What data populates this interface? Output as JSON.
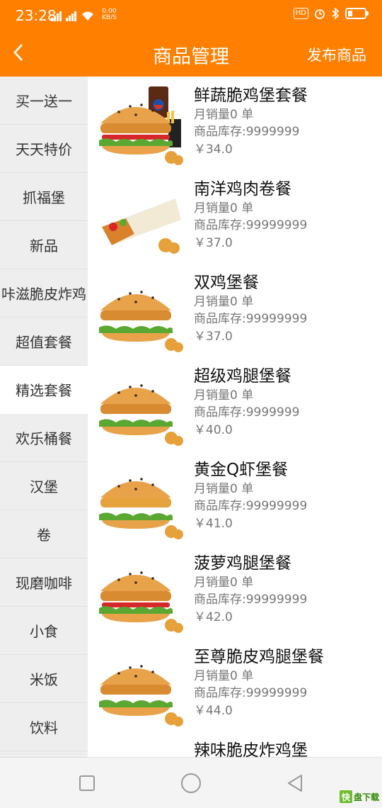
{
  "status_bar": {
    "time": "23:28",
    "network_speed": "0.00",
    "network_unit": "KB/S",
    "hd_label": "HD",
    "battery_level": 0.25
  },
  "header": {
    "title": "商品管理",
    "publish_label": "发布商品"
  },
  "sidebar": {
    "items": [
      {
        "label": "买一送一",
        "active": false
      },
      {
        "label": "天天特价",
        "active": false
      },
      {
        "label": "抓福堡",
        "active": false
      },
      {
        "label": "新品",
        "active": false
      },
      {
        "label": "咔滋脆皮炸鸡",
        "active": false
      },
      {
        "label": "超值套餐",
        "active": false
      },
      {
        "label": "精选套餐",
        "active": true
      },
      {
        "label": "欢乐桶餐",
        "active": false
      },
      {
        "label": "汉堡",
        "active": false
      },
      {
        "label": "卷",
        "active": false
      },
      {
        "label": "现磨咖啡",
        "active": false
      },
      {
        "label": "小食",
        "active": false
      },
      {
        "label": "米饭",
        "active": false
      },
      {
        "label": "饮料",
        "active": false
      }
    ]
  },
  "products": [
    {
      "name": "鲜蔬脆鸡堡套餐",
      "sales": "月销量0 单",
      "stock": "商品库存:9999999",
      "price": "￥34.0",
      "image": "burger-combo-with-drink"
    },
    {
      "name": "南洋鸡肉卷餐",
      "sales": "月销量0 单",
      "stock": "商品库存:99999999",
      "price": "￥37.0",
      "image": "chicken-wrap"
    },
    {
      "name": "双鸡堡餐",
      "sales": "月销量0 单",
      "stock": "商品库存:99999999",
      "price": "￥37.0",
      "image": "chicken-burger"
    },
    {
      "name": "超级鸡腿堡餐",
      "sales": "月销量0 单",
      "stock": "商品库存:9999999",
      "price": "￥40.0",
      "image": "chicken-burger"
    },
    {
      "name": "黄金Q虾堡餐",
      "sales": "月销量0 单",
      "stock": "商品库存:99999999",
      "price": "￥41.0",
      "image": "shrimp-burger"
    },
    {
      "name": "菠萝鸡腿堡餐",
      "sales": "月销量0 单",
      "stock": "商品库存:99999999",
      "price": "￥42.0",
      "image": "pineapple-burger"
    },
    {
      "name": "至尊脆皮鸡腿堡餐",
      "sales": "月销量0 单",
      "stock": "商品库存:99999999",
      "price": "￥44.0",
      "image": "deluxe-burger"
    },
    {
      "name": "辣味脆皮炸鸡堡",
      "sales": "",
      "stock": "",
      "price": "",
      "image": "spicy-burger"
    }
  ],
  "watermark": {
    "logo_char": "快",
    "text": "盘下载"
  },
  "colors": {
    "accent": "#FF7F00",
    "sidebar_bg": "#EEEEEE",
    "text_muted": "#777777"
  }
}
